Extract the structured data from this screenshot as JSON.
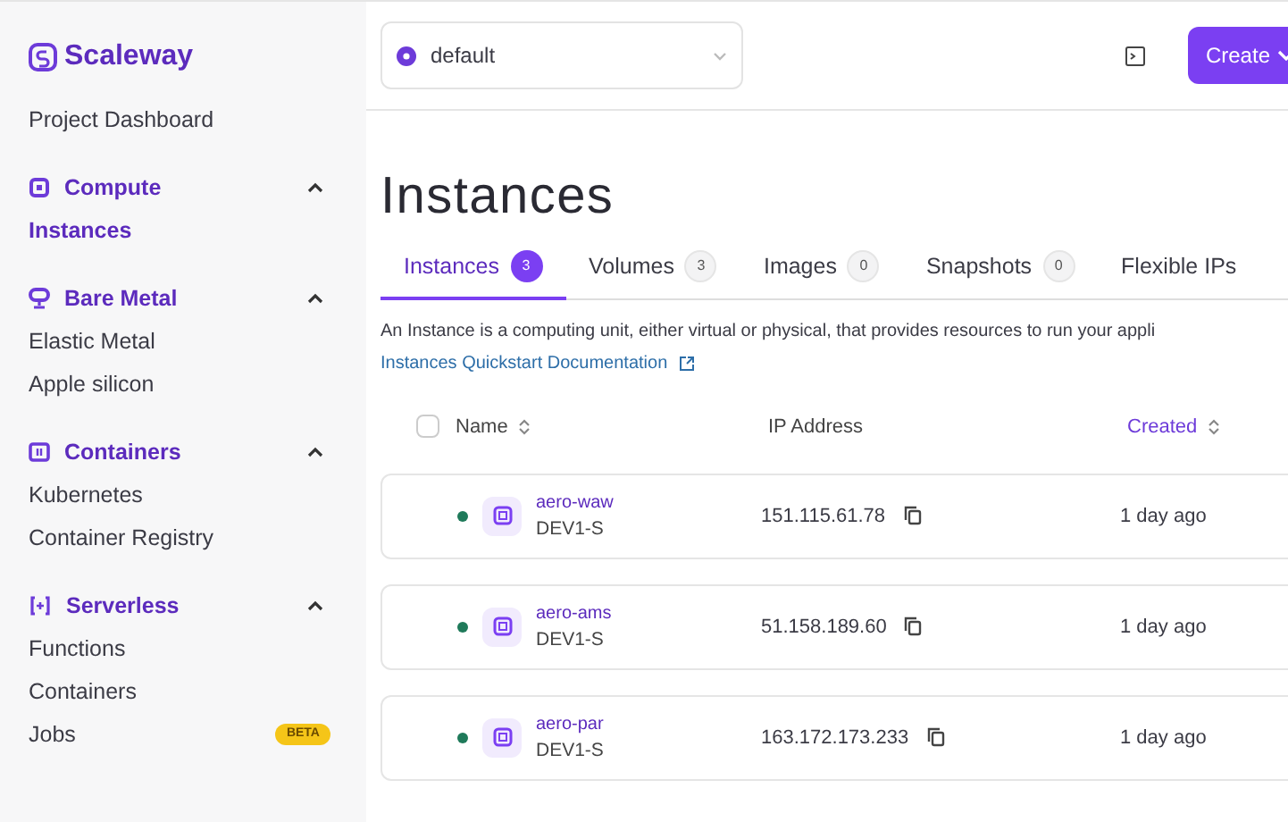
{
  "sidebar": {
    "logo": "Scaleway",
    "top_items": [
      {
        "label": "Project Dashboard",
        "selected": false
      }
    ],
    "sections": [
      {
        "label": "Compute",
        "kind": "chip",
        "expanded": true,
        "children": [
          {
            "label": "Instances",
            "selected": true
          }
        ]
      },
      {
        "label": "Bare Metal",
        "kind": "server",
        "expanded": true,
        "children": [
          {
            "label": "Elastic Metal",
            "selected": false
          },
          {
            "label": "Apple silicon",
            "selected": false
          }
        ]
      },
      {
        "label": "Containers",
        "kind": "box",
        "expanded": true,
        "children": [
          {
            "label": "Kubernetes",
            "selected": false
          },
          {
            "label": "Container Registry",
            "selected": false
          }
        ]
      },
      {
        "label": "Serverless",
        "kind": "braces",
        "expanded": true,
        "children": [
          {
            "label": "Functions",
            "selected": false
          },
          {
            "label": "Containers",
            "selected": false
          },
          {
            "label": "Jobs",
            "selected": false,
            "badge": "BETA"
          }
        ]
      }
    ]
  },
  "topbar": {
    "project": "default",
    "create_button": "Create"
  },
  "page": {
    "title": "Instances",
    "tabs": [
      {
        "label": "Instances",
        "count": "3",
        "selected": true
      },
      {
        "label": "Volumes",
        "count": "3",
        "selected": false
      },
      {
        "label": "Images",
        "count": "0",
        "selected": false
      },
      {
        "label": "Snapshots",
        "count": "0",
        "selected": false
      },
      {
        "label": "Flexible IPs",
        "selected": false
      }
    ],
    "description": "An Instance is a computing unit, either virtual or physical, that provides resources to run your appli",
    "doc_link": "Instances Quickstart Documentation"
  },
  "table": {
    "columns": [
      {
        "label": "Name",
        "sortable": true,
        "active": false
      },
      {
        "label": "IP Address",
        "sortable": false,
        "active": false
      },
      {
        "label": "Created",
        "sortable": true,
        "active": true
      }
    ],
    "select_all": {
      "checked": false
    },
    "rows": [
      {
        "name": "aero-waw",
        "type": "DEV1-S",
        "color": "#1f7a5a",
        "ip": "151.115.61.78",
        "created": "1 day ago"
      },
      {
        "name": "aero-ams",
        "type": "DEV1-S",
        "color": "#1f7a5a",
        "ip": "51.158.189.60",
        "created": "1 day ago"
      },
      {
        "name": "aero-par",
        "type": "DEV1-S",
        "color": "#1f7a5a",
        "ip": "163.172.173.233",
        "created": "1 day ago"
      }
    ]
  }
}
